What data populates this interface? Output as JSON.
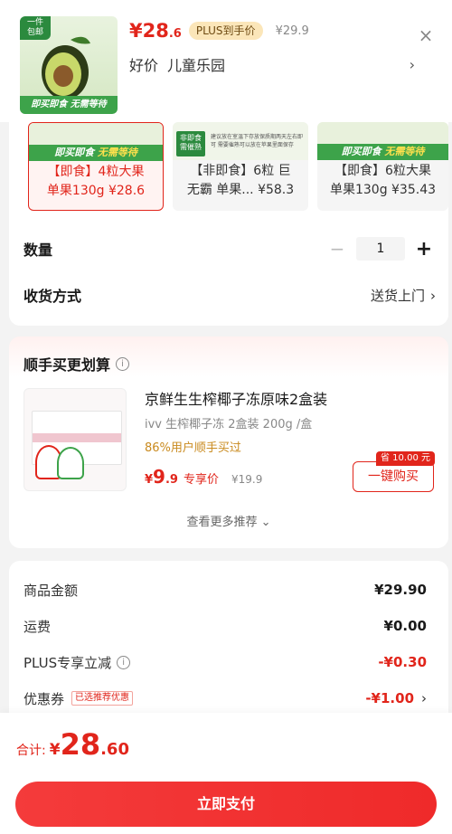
{
  "product": {
    "thumb_tag": "一件包邮",
    "thumb_band": "即买即食 无需等待",
    "price_int": "¥28",
    "price_dec": ".6",
    "plus_badge": "PLUS到手价",
    "orig_price": "¥29.9",
    "promo_1": "好价",
    "promo_2": "儿童乐园",
    "close_icon": "×",
    "chevron": "›"
  },
  "variants": [
    {
      "band_a": "即买即食",
      "band_b": "无需等待",
      "line1": "【即食】4粒大果",
      "line2": "单果130g ¥28.6",
      "selected": true
    },
    {
      "tag": "非即食 需催熟",
      "fine": "建议放在室温下存放保质期两天左右即可 需要催熟可以放在苹果里面保存",
      "line1": "【非即食】6粒 巨",
      "line2": "无霸 单果... ¥58.3",
      "selected": false
    },
    {
      "band_a": "即买即食",
      "band_b": "无需等待",
      "line1": "【即食】6粒大果",
      "line2": "单果130g ¥35.43",
      "selected": false
    }
  ],
  "quantity": {
    "label": "数量",
    "minus": "−",
    "value": "1",
    "plus": "+"
  },
  "delivery": {
    "label": "收货方式",
    "value": "送货上门",
    "chevron": "›"
  },
  "bundle": {
    "title": "顺手买更划算",
    "info_icon": "i",
    "name": "京鲜生生榨椰子冻原味2盒装",
    "spec": "ivv 生榨椰子冻 2盒装 200g /盒",
    "stat": "86%用户顺手买过",
    "price_yen": "¥",
    "price_int": "9",
    "price_dec": ".9",
    "price_label": "专享价",
    "orig_price": "¥19.9",
    "save_badge": "省 10.00 元",
    "buy_label": "一键购买",
    "more_label": "查看更多推荐 ⌄"
  },
  "summary": {
    "rows": [
      {
        "label": "商品金额",
        "amount": "¥29.90"
      },
      {
        "label": "运费",
        "amount": "¥0.00"
      },
      {
        "label": "PLUS专享立减",
        "amount": "-¥0.30"
      },
      {
        "label": "优惠券",
        "tag": "已选推荐优惠",
        "amount": "-¥1.00"
      }
    ]
  },
  "footer": {
    "total_label": "合计:",
    "total_yen": "¥",
    "total_int": "28",
    "total_dec": ".60",
    "pay_label": "立即支付"
  },
  "colors": {
    "accent": "#e1251b",
    "green": "#3da34a",
    "plus_gold": "#fbe6b9"
  }
}
